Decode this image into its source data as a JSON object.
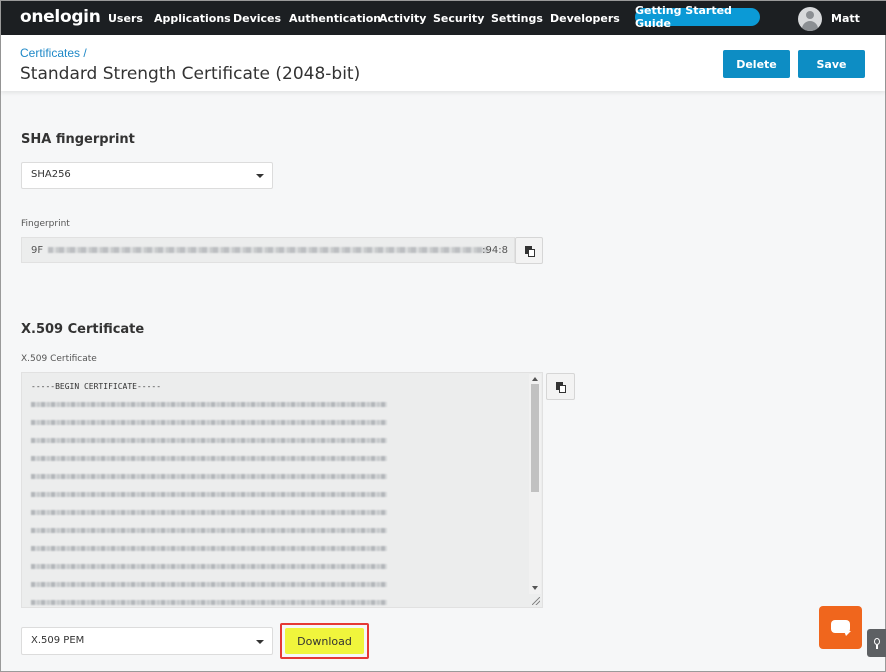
{
  "nav": {
    "logo": "onelogin",
    "items": [
      "Users",
      "Applications",
      "Devices",
      "Authentication",
      "Activity",
      "Security",
      "Settings",
      "Developers"
    ],
    "getting_started": "Getting Started Guide",
    "user_name": "Matt"
  },
  "header": {
    "breadcrumb": "Certificates /",
    "title": "Standard Strength Certificate (2048-bit)",
    "delete_label": "Delete",
    "save_label": "Save"
  },
  "sha": {
    "section_title": "SHA fingerprint",
    "algorithm": "SHA256",
    "fingerprint_label": "Fingerprint",
    "fingerprint_start": "9F",
    "fingerprint_end": ":94:8"
  },
  "x509": {
    "section_title": "X.509 Certificate",
    "field_label": "X.509 Certificate",
    "begin_line": "-----BEGIN CERTIFICATE-----",
    "format": "X.509 PEM",
    "download_label": "Download"
  },
  "colors": {
    "accent": "#0d8dc4",
    "nav_bg": "#1c1f22",
    "highlight": "#f0f53c",
    "highlight_border": "#e53935",
    "chat": "#f0661d"
  }
}
